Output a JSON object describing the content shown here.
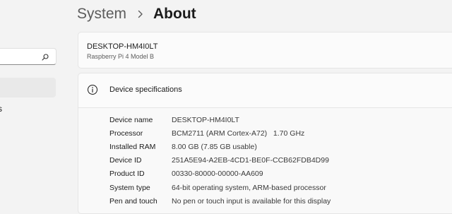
{
  "nav": {
    "search_placeholder": "",
    "partial_item_label": "s"
  },
  "header": {
    "parent": "System",
    "current": "About"
  },
  "device": {
    "name": "DESKTOP-HM4I0LT",
    "model": "Raspberry Pi 4 Model B"
  },
  "specs": {
    "title": "Device specifications",
    "rows": [
      {
        "label": "Device name",
        "value": "DESKTOP-HM4I0LT"
      },
      {
        "label": "Processor",
        "value": "BCM2711 (ARM Cortex-A72)   1.70 GHz"
      },
      {
        "label": "Installed RAM",
        "value": "8.00 GB (7.85 GB usable)"
      },
      {
        "label": "Device ID",
        "value": "251A5E94-A2EB-4CD1-BE0F-CCB62FDB4D99"
      },
      {
        "label": "Product ID",
        "value": "00330-80000-00000-AA609"
      },
      {
        "label": "System type",
        "value": "64-bit operating system, ARM-based processor"
      },
      {
        "label": "Pen and touch",
        "value": "No pen or touch input is available for this display"
      }
    ]
  },
  "icons": {
    "search": "search-icon",
    "chevron": "chevron-right-icon",
    "info": "info-icon"
  },
  "colors": {
    "background": "#f3f3f3",
    "card": "#fbfbfb",
    "nav_selected": "#e9e9e9"
  }
}
